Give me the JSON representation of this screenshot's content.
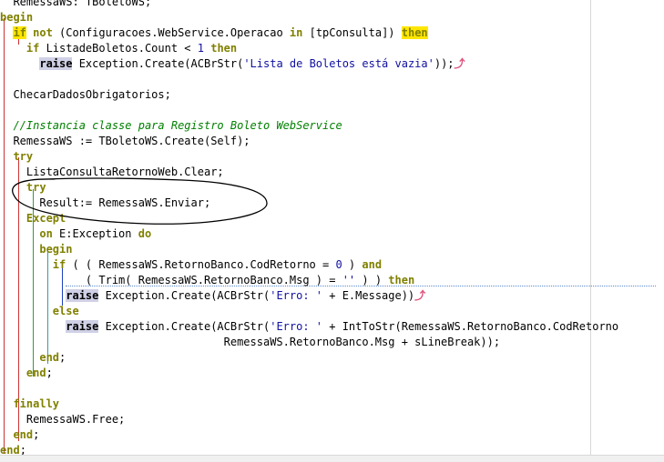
{
  "lines": [
    {
      "id": "l0",
      "segments": [
        {
          "t": "  RemessaWS: TBoletoWS;"
        }
      ]
    },
    {
      "id": "l1",
      "segments": [
        {
          "t": "begin",
          "c": "kw"
        }
      ]
    },
    {
      "id": "l2",
      "segments": [
        {
          "t": "  "
        },
        {
          "t": "if",
          "c": "kw-hl"
        },
        {
          "t": " "
        },
        {
          "t": "not",
          "c": "kw"
        },
        {
          "t": " (Configuracoes.WebService.Operacao "
        },
        {
          "t": "in",
          "c": "kw"
        },
        {
          "t": " [tpConsulta]) "
        },
        {
          "t": "then",
          "c": "kw-hl"
        }
      ]
    },
    {
      "id": "l3",
      "segments": [
        {
          "t": "    "
        },
        {
          "t": "if",
          "c": "kw"
        },
        {
          "t": " ListadeBoletos.Count < "
        },
        {
          "t": "1",
          "c": "nm"
        },
        {
          "t": " "
        },
        {
          "t": "then",
          "c": "kw"
        }
      ]
    },
    {
      "id": "l4",
      "segments": [
        {
          "t": "      "
        },
        {
          "t": "raise",
          "c": "kw-box"
        },
        {
          "t": " Exception.Create(ACBrStr("
        },
        {
          "t": "'Lista de Boletos está vazia'",
          "c": "st"
        },
        {
          "t": "));"
        }
      ],
      "arrow": true
    },
    {
      "id": "l5",
      "segments": [
        {
          "t": ""
        }
      ]
    },
    {
      "id": "l6",
      "segments": [
        {
          "t": "  ChecarDadosObrigatorios;"
        }
      ]
    },
    {
      "id": "l7",
      "segments": [
        {
          "t": ""
        }
      ]
    },
    {
      "id": "l8",
      "segments": [
        {
          "t": "  "
        },
        {
          "t": "//Instancia classe para Registro Boleto WebService",
          "c": "cm"
        }
      ]
    },
    {
      "id": "l9",
      "segments": [
        {
          "t": "  RemessaWS := TBoletoWS.Create(Self);"
        }
      ]
    },
    {
      "id": "l10",
      "segments": [
        {
          "t": "  "
        },
        {
          "t": "try",
          "c": "kw"
        }
      ]
    },
    {
      "id": "l11",
      "segments": [
        {
          "t": "    ListaConsultaRetornoWeb.Clear;"
        }
      ]
    },
    {
      "id": "l12",
      "segments": [
        {
          "t": "    "
        },
        {
          "t": "try",
          "c": "kw"
        }
      ]
    },
    {
      "id": "l13",
      "segments": [
        {
          "t": "      Result:= RemessaWS.Enviar;"
        }
      ]
    },
    {
      "id": "l14",
      "segments": [
        {
          "t": "    "
        },
        {
          "t": "Except",
          "c": "kw"
        }
      ]
    },
    {
      "id": "l15",
      "segments": [
        {
          "t": "      "
        },
        {
          "t": "on",
          "c": "kw"
        },
        {
          "t": " E:Exception "
        },
        {
          "t": "do",
          "c": "kw"
        }
      ]
    },
    {
      "id": "l16",
      "segments": [
        {
          "t": "      "
        },
        {
          "t": "begin",
          "c": "kw"
        }
      ]
    },
    {
      "id": "l17",
      "segments": [
        {
          "t": "        "
        },
        {
          "t": "if",
          "c": "kw"
        },
        {
          "t": " ( ( RemessaWS.RetornoBanco.CodRetorno = "
        },
        {
          "t": "0",
          "c": "nm"
        },
        {
          "t": " ) "
        },
        {
          "t": "and",
          "c": "kw"
        }
      ]
    },
    {
      "id": "l18",
      "segments": [
        {
          "t": "             ( Trim( RemessaWS.RetornoBanco.Msg ) = "
        },
        {
          "t": "''",
          "c": "st"
        },
        {
          "t": " ) ) "
        },
        {
          "t": "then",
          "c": "kw"
        }
      ]
    },
    {
      "id": "l19",
      "segments": [
        {
          "t": "          "
        },
        {
          "t": "raise",
          "c": "kw-box"
        },
        {
          "t": " Exception.Create(ACBrStr("
        },
        {
          "t": "'Erro: '",
          "c": "st"
        },
        {
          "t": " + E.Message))"
        }
      ],
      "arrow": true
    },
    {
      "id": "l20",
      "segments": [
        {
          "t": "        "
        },
        {
          "t": "else",
          "c": "kw"
        }
      ]
    },
    {
      "id": "l21",
      "segments": [
        {
          "t": "          "
        },
        {
          "t": "raise",
          "c": "kw-box"
        },
        {
          "t": " Exception.Create(ACBrStr("
        },
        {
          "t": "'Erro: '",
          "c": "st"
        },
        {
          "t": " + IntToStr(RemessaWS.RetornoBanco.CodRetorno"
        }
      ]
    },
    {
      "id": "l22",
      "segments": [
        {
          "t": "                                  RemessaWS.RetornoBanco.Msg + sLineBreak));"
        }
      ]
    },
    {
      "id": "l23",
      "segments": [
        {
          "t": "      "
        },
        {
          "t": "end",
          "c": "kw"
        },
        {
          "t": ";"
        }
      ]
    },
    {
      "id": "l24",
      "segments": [
        {
          "t": "    "
        },
        {
          "t": "end",
          "c": "kw"
        },
        {
          "t": ";"
        }
      ]
    },
    {
      "id": "l25",
      "segments": [
        {
          "t": ""
        }
      ]
    },
    {
      "id": "l26",
      "segments": [
        {
          "t": "  "
        },
        {
          "t": "finally",
          "c": "kw"
        }
      ]
    },
    {
      "id": "l27",
      "segments": [
        {
          "t": "    RemessaWS.Free;"
        }
      ]
    },
    {
      "id": "l28",
      "segments": [
        {
          "t": "  "
        },
        {
          "t": "end",
          "c": "kw"
        },
        {
          "t": ";"
        }
      ]
    },
    {
      "id": "l29",
      "segments": [
        {
          "t": "end",
          "c": "kw"
        },
        {
          "t": ";"
        }
      ]
    }
  ],
  "icons": {
    "raise_marker": "return-arrow-icon",
    "raise_marker_glyph": "⤴"
  },
  "colors": {
    "keyword": "#808000",
    "highlight": "#ffe600",
    "comment": "#008000",
    "string": "#1010a0",
    "raise_bg": "#d0d0e6",
    "annotation": "#000000"
  }
}
